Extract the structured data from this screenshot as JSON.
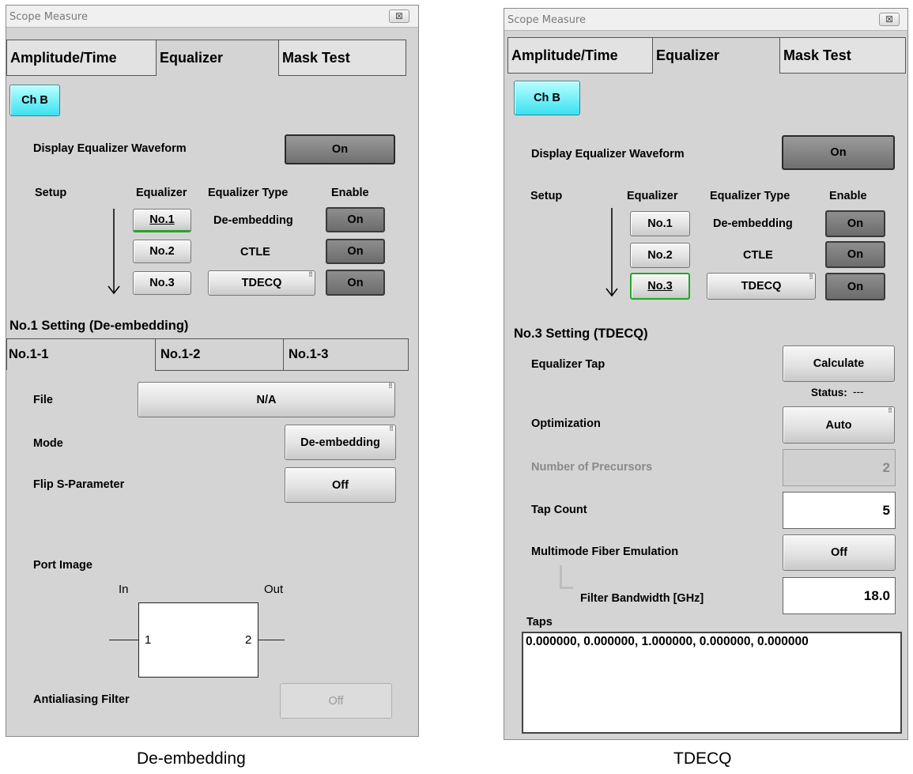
{
  "left": {
    "title": "Scope Measure",
    "close_glyph": "⊠",
    "tabs": [
      "Amplitude/Time",
      "Equalizer",
      "Mask Test"
    ],
    "channel_button": "Ch B",
    "display_waveform": {
      "label": "Display Equalizer Waveform",
      "value": "On"
    },
    "table_headers": {
      "setup": "Setup",
      "equalizer": "Equalizer",
      "type": "Equalizer Type",
      "enable": "Enable"
    },
    "rows": [
      {
        "eq": "No.1",
        "type": "De-embedding",
        "enable": "On"
      },
      {
        "eq": "No.2",
        "type": "CTLE",
        "enable": "On"
      },
      {
        "eq": "No.3",
        "type": "TDECQ",
        "enable": "On"
      }
    ],
    "section_title": "No.1 Setting (De-embedding)",
    "subtabs": [
      "No.1-1",
      "No.1-2",
      "No.1-3"
    ],
    "file": {
      "label": "File",
      "value": "N/A"
    },
    "mode": {
      "label": "Mode",
      "value": "De-embedding"
    },
    "flip": {
      "label": "Flip S-Parameter",
      "value": "Off"
    },
    "port_image": {
      "label": "Port Image",
      "in": "In",
      "out": "Out",
      "port1": "1",
      "port2": "2"
    },
    "antialias": {
      "label": "Antialiasing Filter",
      "value": "Off"
    }
  },
  "right": {
    "title": "Scope Measure",
    "close_glyph": "⊠",
    "tabs": [
      "Amplitude/Time",
      "Equalizer",
      "Mask Test"
    ],
    "channel_button": "Ch B",
    "display_waveform": {
      "label": "Display Equalizer Waveform",
      "value": "On"
    },
    "table_headers": {
      "setup": "Setup",
      "equalizer": "Equalizer",
      "type": "Equalizer Type",
      "enable": "Enable"
    },
    "rows": [
      {
        "eq": "No.1",
        "type": "De-embedding",
        "enable": "On"
      },
      {
        "eq": "No.2",
        "type": "CTLE",
        "enable": "On"
      },
      {
        "eq": "No.3",
        "type": "TDECQ",
        "enable": "On"
      }
    ],
    "section_title": "No.3 Setting (TDECQ)",
    "eq_tap": {
      "label": "Equalizer Tap",
      "button": "Calculate",
      "status_label": "Status:",
      "status_value": "---"
    },
    "optimization": {
      "label": "Optimization",
      "value": "Auto"
    },
    "precursors": {
      "label": "Number of Precursors",
      "value": "2"
    },
    "tap_count": {
      "label": "Tap Count",
      "value": "5"
    },
    "mmf": {
      "label": "Multimode Fiber Emulation",
      "value": "Off"
    },
    "filter_bw": {
      "label": "Filter Bandwidth [GHz]",
      "value": "18.0"
    },
    "taps": {
      "label": "Taps",
      "value": "0.000000, 0.000000, 1.000000, 0.000000, 0.000000"
    }
  },
  "captions": {
    "left": "De-embedding",
    "right": "TDECQ"
  }
}
